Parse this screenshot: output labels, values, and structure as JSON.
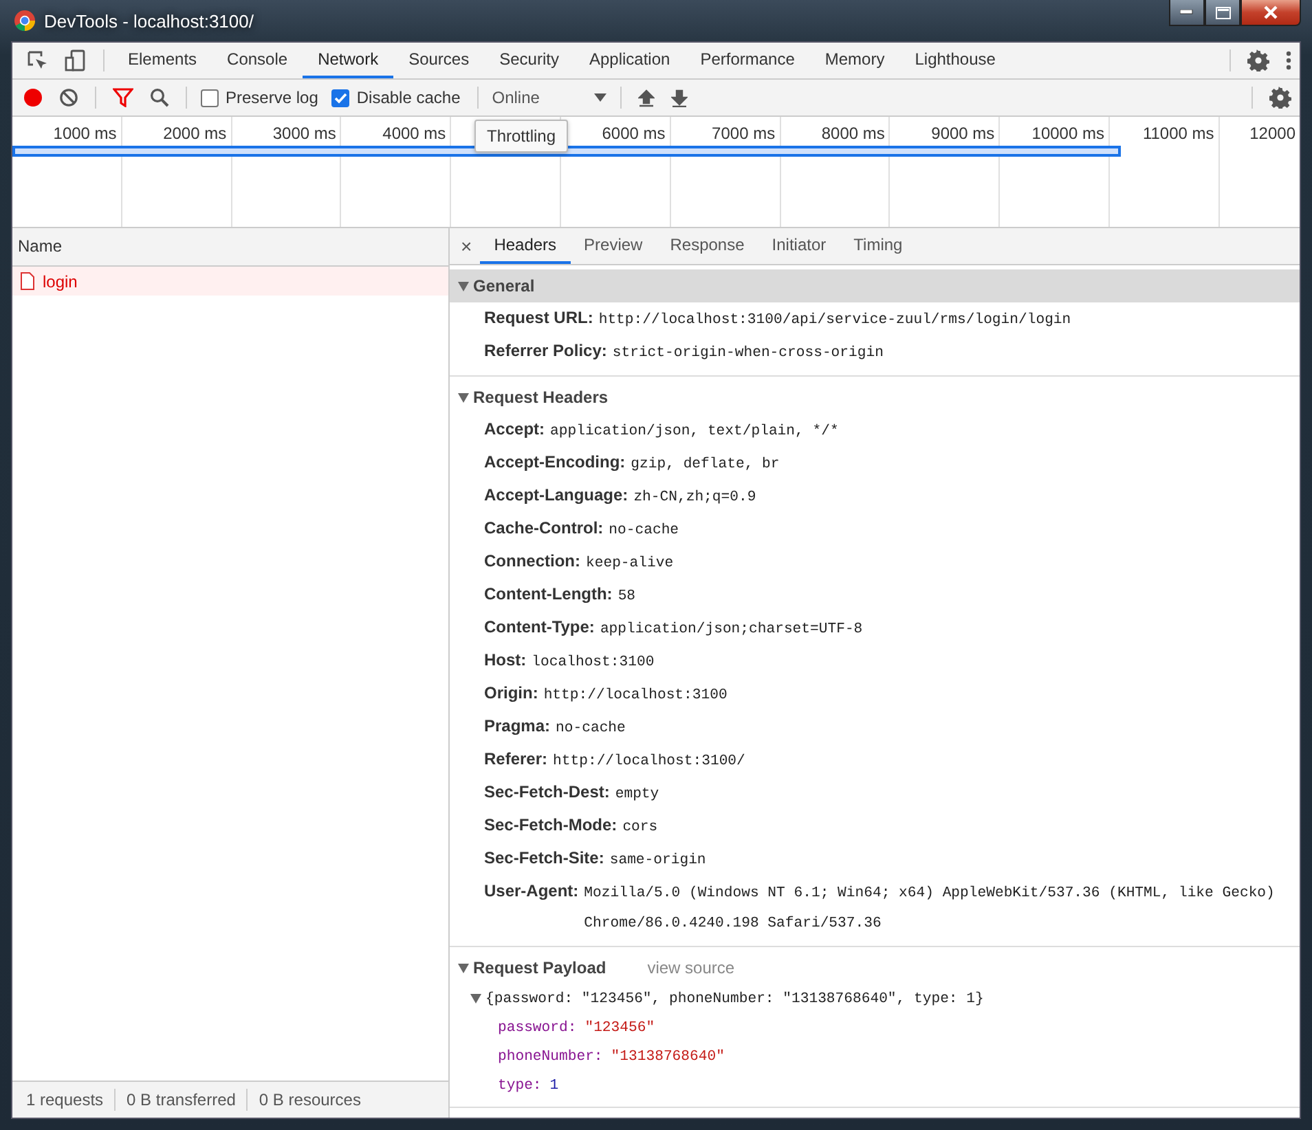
{
  "window": {
    "title": "DevTools - localhost:3100/"
  },
  "main_tabs": [
    {
      "label": "Elements",
      "selected": false
    },
    {
      "label": "Console",
      "selected": false
    },
    {
      "label": "Network",
      "selected": true
    },
    {
      "label": "Sources",
      "selected": false
    },
    {
      "label": "Security",
      "selected": false
    },
    {
      "label": "Application",
      "selected": false
    },
    {
      "label": "Performance",
      "selected": false
    },
    {
      "label": "Memory",
      "selected": false
    },
    {
      "label": "Lighthouse",
      "selected": false
    }
  ],
  "toolbar": {
    "recording": true,
    "filter_on": true,
    "options": [
      {
        "label": "Preserve log",
        "checked": false
      },
      {
        "label": "Disable cache",
        "checked": true
      }
    ],
    "throttling": "Online"
  },
  "timeline": {
    "ticks": [
      "1000 ms",
      "2000 ms",
      "3000 ms",
      "4000 ms",
      "6000 ms",
      "7000 ms",
      "8000 ms",
      "9000 ms",
      "10000 ms",
      "11000 ms",
      "12000"
    ],
    "tooltip": "Throttling"
  },
  "requests": {
    "column": "Name",
    "rows": [
      {
        "name": "login",
        "selected": true,
        "failed": true
      }
    ]
  },
  "status_bar": [
    "1 requests",
    "0 B transferred",
    "0 B resources"
  ],
  "details": {
    "close": "×",
    "tabs": [
      {
        "label": "Headers",
        "selected": true
      },
      {
        "label": "Preview",
        "selected": false
      },
      {
        "label": "Response",
        "selected": false
      },
      {
        "label": "Initiator",
        "selected": false
      },
      {
        "label": "Timing",
        "selected": false
      }
    ],
    "sections": [
      {
        "kind": "headers",
        "title": "General",
        "expanded": true,
        "focused": true,
        "rows": [
          {
            "name": "Request URL:",
            "value": "http://localhost:3100/api/service-zuul/rms/login/login"
          },
          {
            "name": "Referrer Policy:",
            "value": "strict-origin-when-cross-origin"
          }
        ]
      },
      {
        "kind": "headers",
        "title": "Request Headers",
        "expanded": true,
        "focused": false,
        "rows": [
          {
            "name": "Accept:",
            "value": "application/json, text/plain, */*"
          },
          {
            "name": "Accept-Encoding:",
            "value": "gzip, deflate, br"
          },
          {
            "name": "Accept-Language:",
            "value": "zh-CN,zh;q=0.9"
          },
          {
            "name": "Cache-Control:",
            "value": "no-cache"
          },
          {
            "name": "Connection:",
            "value": "keep-alive"
          },
          {
            "name": "Content-Length:",
            "value": "58"
          },
          {
            "name": "Content-Type:",
            "value": "application/json;charset=UTF-8"
          },
          {
            "name": "Host:",
            "value": "localhost:3100"
          },
          {
            "name": "Origin:",
            "value": "http://localhost:3100"
          },
          {
            "name": "Pragma:",
            "value": "no-cache"
          },
          {
            "name": "Referer:",
            "value": "http://localhost:3100/"
          },
          {
            "name": "Sec-Fetch-Dest:",
            "value": "empty"
          },
          {
            "name": "Sec-Fetch-Mode:",
            "value": "cors"
          },
          {
            "name": "Sec-Fetch-Site:",
            "value": "same-origin"
          },
          {
            "name": "User-Agent:",
            "value": "Mozilla/5.0 (Windows NT 6.1; Win64; x64) AppleWebKit/537.36 (KHTML, like Gecko) Chrome/86.0.4240.198 Safari/537.36"
          }
        ]
      },
      {
        "kind": "payload",
        "title": "Request Payload",
        "expanded": true,
        "focused": false,
        "link": "view source",
        "summary": "{password: \"123456\", phoneNumber: \"13138768640\", type: 1}",
        "properties": [
          {
            "key": "password:",
            "value": "\"123456\"",
            "color": "#c41a16"
          },
          {
            "key": "phoneNumber:",
            "value": "\"13138768640\"",
            "color": "#c41a16"
          },
          {
            "key": "type:",
            "value": "1",
            "color": "#1a1aa6"
          }
        ]
      }
    ]
  }
}
